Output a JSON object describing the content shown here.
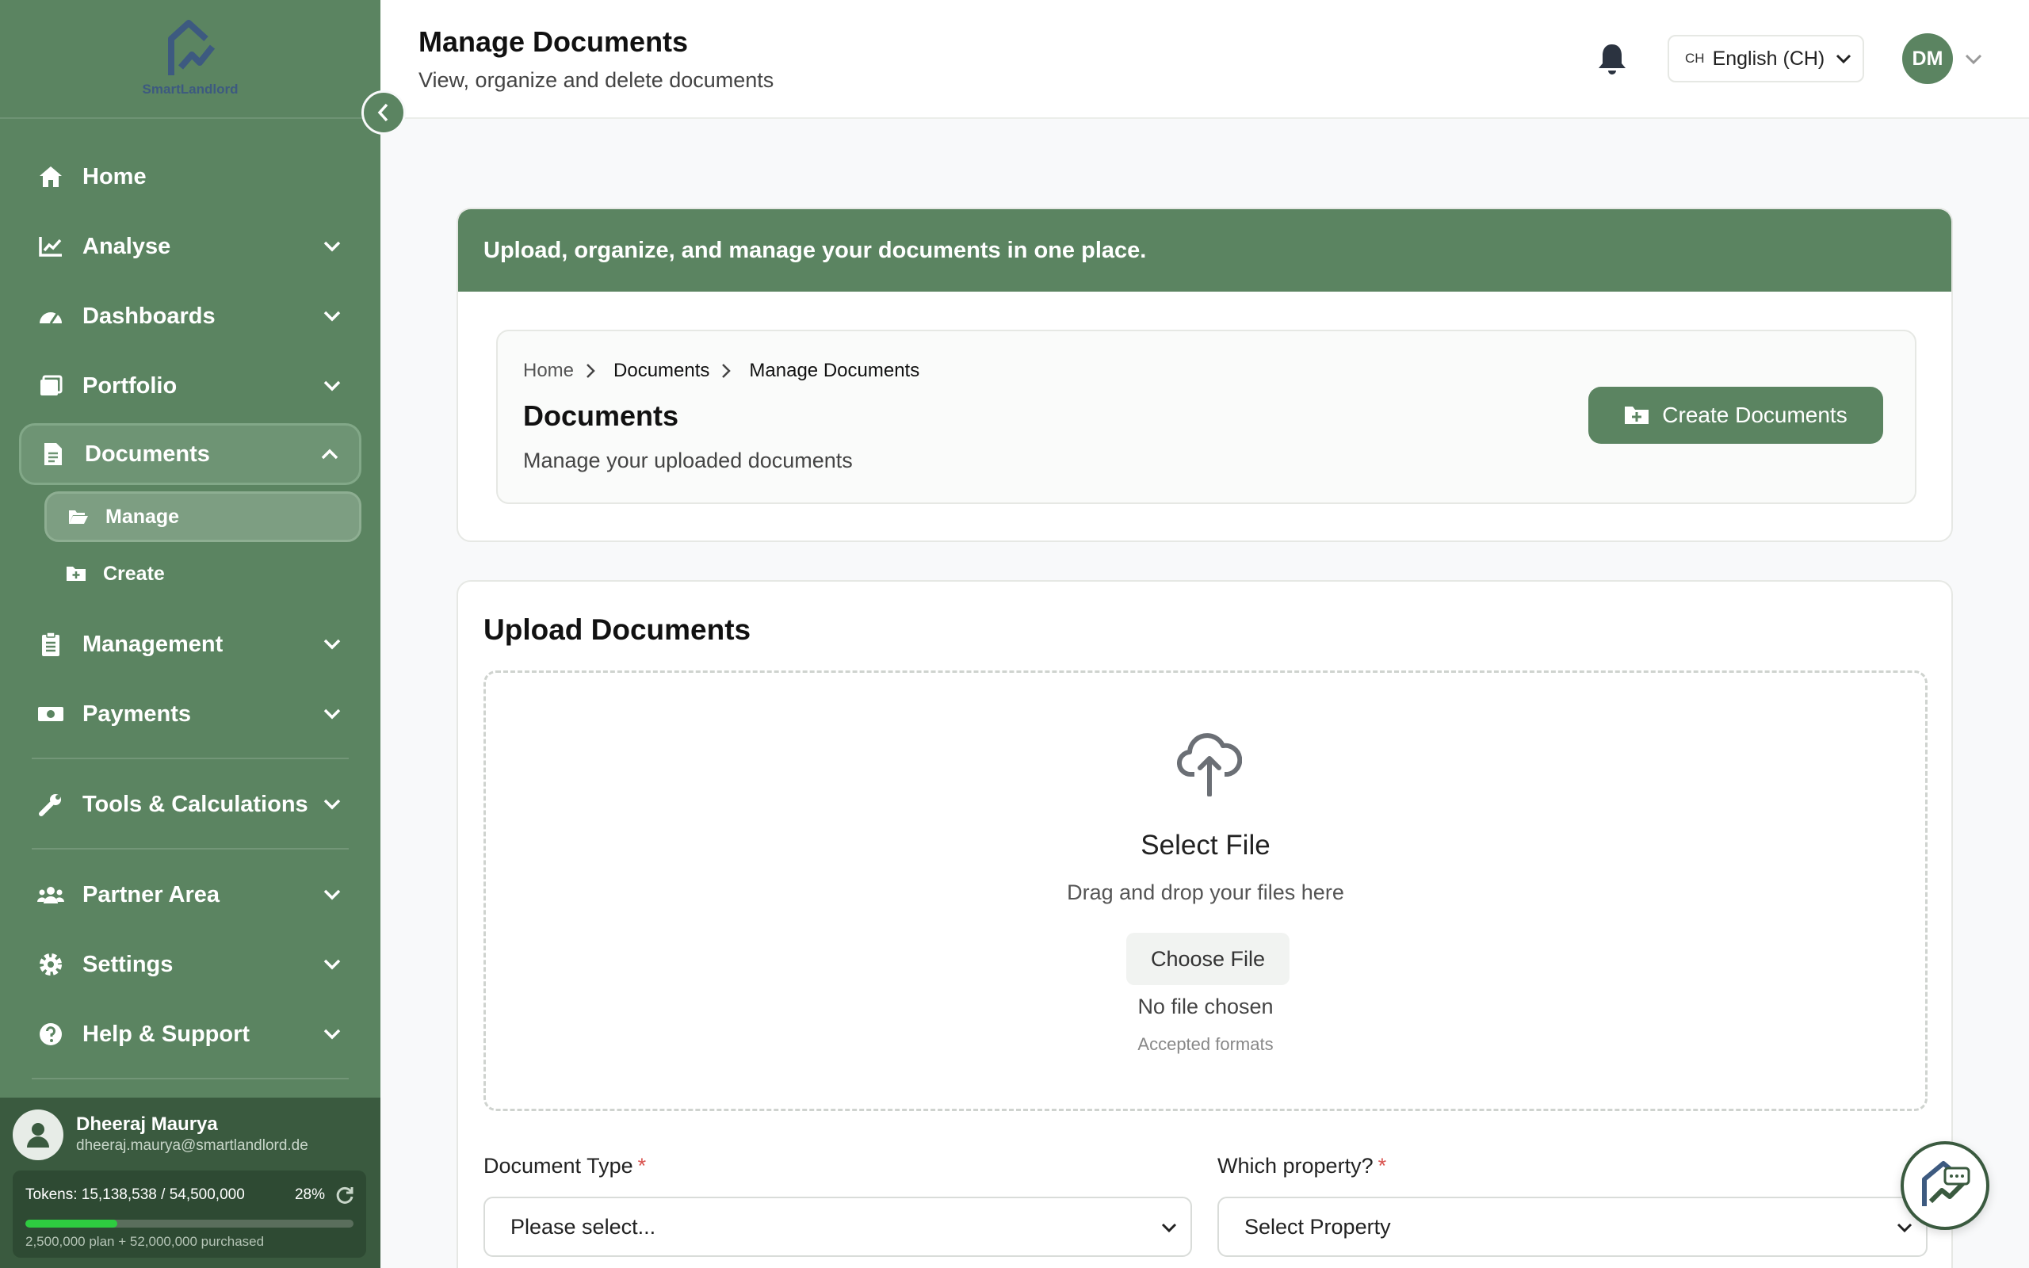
{
  "brand": {
    "name": "SmartLandlord"
  },
  "sidebar": {
    "items": [
      {
        "label": "Home",
        "icon": "home-icon"
      },
      {
        "label": "Analyse",
        "icon": "chart-icon"
      },
      {
        "label": "Dashboards",
        "icon": "gauge-icon"
      },
      {
        "label": "Portfolio",
        "icon": "portfolio-icon"
      },
      {
        "label": "Documents",
        "icon": "document-icon"
      },
      {
        "label": "Management",
        "icon": "clipboard-icon"
      },
      {
        "label": "Payments",
        "icon": "money-icon"
      },
      {
        "label": "Tools & Calculations",
        "icon": "wrench-icon"
      },
      {
        "label": "Partner Area",
        "icon": "users-icon"
      },
      {
        "label": "Settings",
        "icon": "gear-icon"
      },
      {
        "label": "Help & Support",
        "icon": "help-icon"
      }
    ],
    "sub_items": [
      {
        "label": "Manage",
        "icon": "folder-open-icon"
      },
      {
        "label": "Create",
        "icon": "folder-plus-icon"
      }
    ]
  },
  "user": {
    "name": "Dheeraj Maurya",
    "email": "dheeraj.maurya@smartlandlord.de",
    "tokens_text": "Tokens: 15,138,538 / 54,500,000",
    "tokens_pct_label": "28%",
    "tokens_fraction": 0.28,
    "tokens_sub": "2,500,000 plan + 52,000,000 purchased"
  },
  "header": {
    "title": "Manage Documents",
    "subtitle": "View, organize and delete documents",
    "lang_code": "CH",
    "lang_label": "English (CH)",
    "avatar_initials": "DM"
  },
  "banner": {
    "text": "Upload, organize, and manage your documents in one place."
  },
  "breadcrumb": [
    "Home",
    "Documents",
    "Manage Documents"
  ],
  "docs": {
    "title": "Documents",
    "subtitle": "Manage your uploaded documents",
    "create_button": "Create Documents"
  },
  "upload": {
    "title": "Upload Documents",
    "select_file": "Select File",
    "drag_drop": "Drag and drop your files here",
    "choose_file": "Choose File",
    "no_file": "No file chosen",
    "accepted": "Accepted formats"
  },
  "form": {
    "doc_type_label": "Document Type",
    "doc_type_value": "Please select...",
    "property_label": "Which property?",
    "property_value": "Select Property",
    "required_mark": "*"
  },
  "colors": {
    "primary": "#5b8461",
    "dark": "#3a5a3f",
    "required": "#d9534f"
  }
}
